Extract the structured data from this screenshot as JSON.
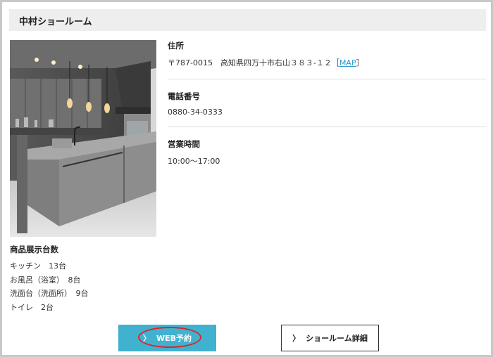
{
  "header": {
    "title": "中村ショールーム"
  },
  "info": {
    "address": {
      "label": "住所",
      "value": "〒787-0015　高知県四万十市右山３８３-１２",
      "bracket_open": "［",
      "map_link": "MAP",
      "bracket_close": "］"
    },
    "phone": {
      "label": "電話番号",
      "value": "0880-34-0333"
    },
    "hours": {
      "label": "営業時間",
      "value": "10:00〜17:00"
    }
  },
  "counts": {
    "label": "商品展示台数",
    "rows": [
      "キッチン　13台",
      "お風呂（浴室）　8台",
      "洗面台（洗面所）　9台",
      "トイレ　2台"
    ]
  },
  "buttons": {
    "web_reserve": "WEB予約",
    "showroom_detail": "ショールーム詳細",
    "chevron": "〉"
  },
  "colors": {
    "accent": "#40b2cf",
    "annotation": "#d9262a",
    "link": "#3399cc"
  }
}
